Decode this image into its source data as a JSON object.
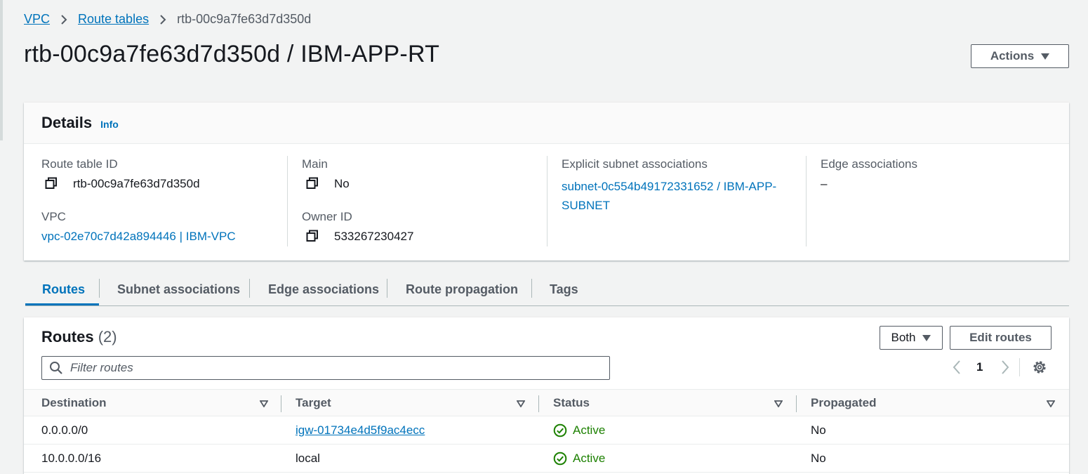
{
  "breadcrumb": {
    "items": [
      "VPC",
      "Route tables"
    ],
    "current": "rtb-00c9a7fe63d7d350d"
  },
  "page_title": "rtb-00c9a7fe63d7d350d / IBM-APP-RT",
  "actions_label": "Actions",
  "details": {
    "title": "Details",
    "info": "Info",
    "route_table_id_label": "Route table ID",
    "route_table_id": "rtb-00c9a7fe63d7d350d",
    "vpc_label": "VPC",
    "vpc": "vpc-02e70c7d42a894446 | IBM-VPC",
    "main_label": "Main",
    "main": "No",
    "owner_label": "Owner ID",
    "owner": "533267230427",
    "explicit_label": "Explicit subnet associations",
    "explicit_line1": "subnet-0c554b49172331652 / IBM-APP-",
    "explicit_line2": "SUBNET",
    "edge_label": "Edge associations",
    "edge": "–"
  },
  "tabs": [
    "Routes",
    "Subnet associations",
    "Edge associations",
    "Route propagation",
    "Tags"
  ],
  "routes": {
    "title": "Routes",
    "count": "(2)",
    "filter_placeholder": "Filter routes",
    "both_label": "Both",
    "edit_label": "Edit routes",
    "page": "1",
    "columns": [
      "Destination",
      "Target",
      "Status",
      "Propagated"
    ],
    "rows": [
      {
        "destination": "0.0.0.0/0",
        "target": "igw-01734e4d5f9ac4ecc",
        "status": "Active",
        "propagated": "No"
      },
      {
        "destination": "10.0.0.0/16",
        "target": "local",
        "status": "Active",
        "propagated": "No"
      }
    ]
  },
  "colors": {
    "link": "#0073bb",
    "success": "#1d8102",
    "text": "#16191f",
    "muted": "#545b64"
  }
}
